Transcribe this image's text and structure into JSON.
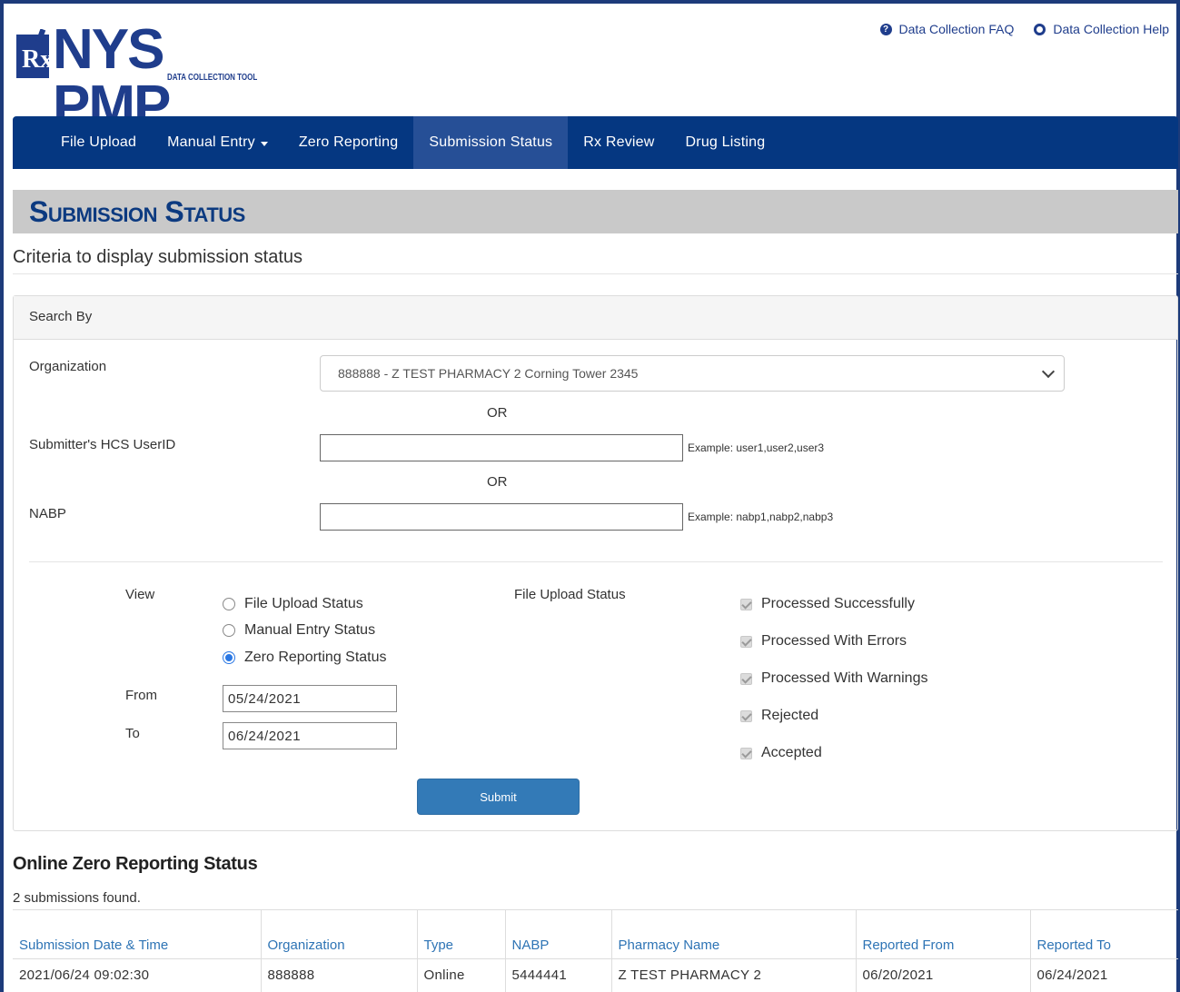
{
  "header": {
    "logo_text": "NYS PMP",
    "logo_rx": "Rx",
    "logo_sub": "DATA COLLECTION TOOL",
    "links": [
      {
        "label": "Data Collection FAQ",
        "icon": "question-icon"
      },
      {
        "label": "Data Collection Help",
        "icon": "lifebuoy-icon"
      }
    ]
  },
  "nav": {
    "items": [
      {
        "label": "File Upload"
      },
      {
        "label": "Manual Entry"
      },
      {
        "label": "Zero Reporting"
      },
      {
        "label": "Submission Status"
      },
      {
        "label": "Rx Review"
      },
      {
        "label": "Drug Listing"
      }
    ],
    "active": "Submission Status"
  },
  "page": {
    "title": "Submission Status",
    "criteria": "Criteria to display submission status"
  },
  "search": {
    "heading": "Search By",
    "organization_label": "Organization",
    "organization_value": "888888 - Z TEST PHARMACY 2 Corning Tower 2345",
    "or1": "OR",
    "userid_label": "Submitter's HCS UserID",
    "userid_value": "",
    "userid_hint": "Example: user1,user2,user3",
    "or2": "OR",
    "nabp_label": "NABP",
    "nabp_value": "",
    "nabp_hint": "Example: nabp1,nabp2,nabp3"
  },
  "view": {
    "label": "View",
    "options": [
      "File Upload Status",
      "Manual Entry Status",
      "Zero Reporting Status"
    ],
    "selected": "Zero Reporting Status",
    "from_label": "From",
    "from_value": "05/24/2021",
    "to_label": "To",
    "to_value": "06/24/2021"
  },
  "file_status": {
    "label": "File Upload Status",
    "options": [
      "Processed Successfully",
      "Processed With Errors",
      "Processed With Warnings",
      "Rejected",
      "Accepted"
    ]
  },
  "submit_label": "Submit",
  "results": {
    "title": "Online Zero Reporting Status",
    "count_text": "2 submissions found.",
    "columns": [
      "Submission Date & Time",
      "Organization",
      "Type",
      "NABP",
      "Pharmacy Name",
      "Reported From",
      "Reported To"
    ],
    "rows": [
      [
        "2021/06/24 09:02:30",
        "888888",
        "Online",
        "5444441",
        "Z TEST PHARMACY 2",
        "06/20/2021",
        "06/24/2021"
      ]
    ]
  }
}
